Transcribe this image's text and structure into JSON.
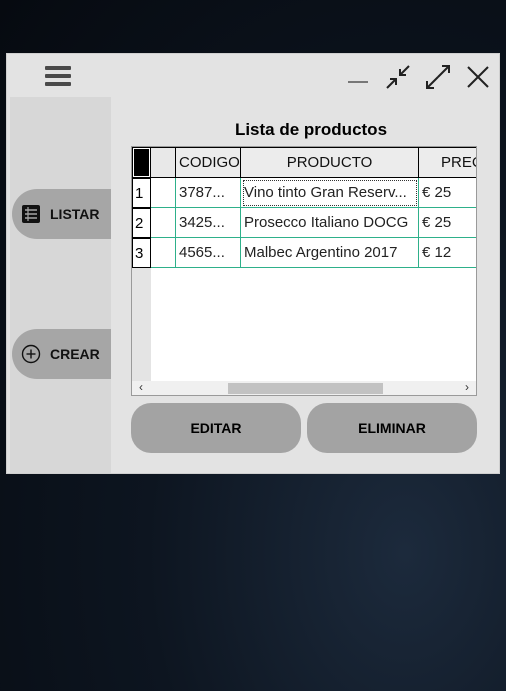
{
  "window": {
    "menu_icon": "hamburger-menu-icon",
    "controls": [
      "minimize-icon",
      "restore-icon",
      "maximize-icon",
      "close-icon"
    ]
  },
  "sidebar": {
    "items": [
      {
        "label": "LISTAR",
        "icon": "list-icon"
      },
      {
        "label": "CREAR",
        "icon": "plus-circle-icon"
      }
    ]
  },
  "main": {
    "title": "Lista de productos",
    "table": {
      "columns": [
        "",
        "CODIGO",
        "PRODUCTO",
        "PREC"
      ],
      "rows": [
        {
          "num": "1",
          "codigo": "3787...",
          "producto": "Vino tinto Gran Reserv...",
          "precio": "€ 25"
        },
        {
          "num": "2",
          "codigo": "3425...",
          "producto": "Prosecco Italiano DOCG",
          "precio": "€ 25"
        },
        {
          "num": "3",
          "codigo": "4565...",
          "producto": "Malbec Argentino 2017",
          "precio": "€ 12"
        }
      ]
    },
    "actions": {
      "edit": "EDITAR",
      "delete": "ELIMINAR"
    }
  },
  "colors": {
    "row_grid": "#2eb08a",
    "button": "#a3a3a3",
    "sidebar_button": "#a6a6a6"
  }
}
